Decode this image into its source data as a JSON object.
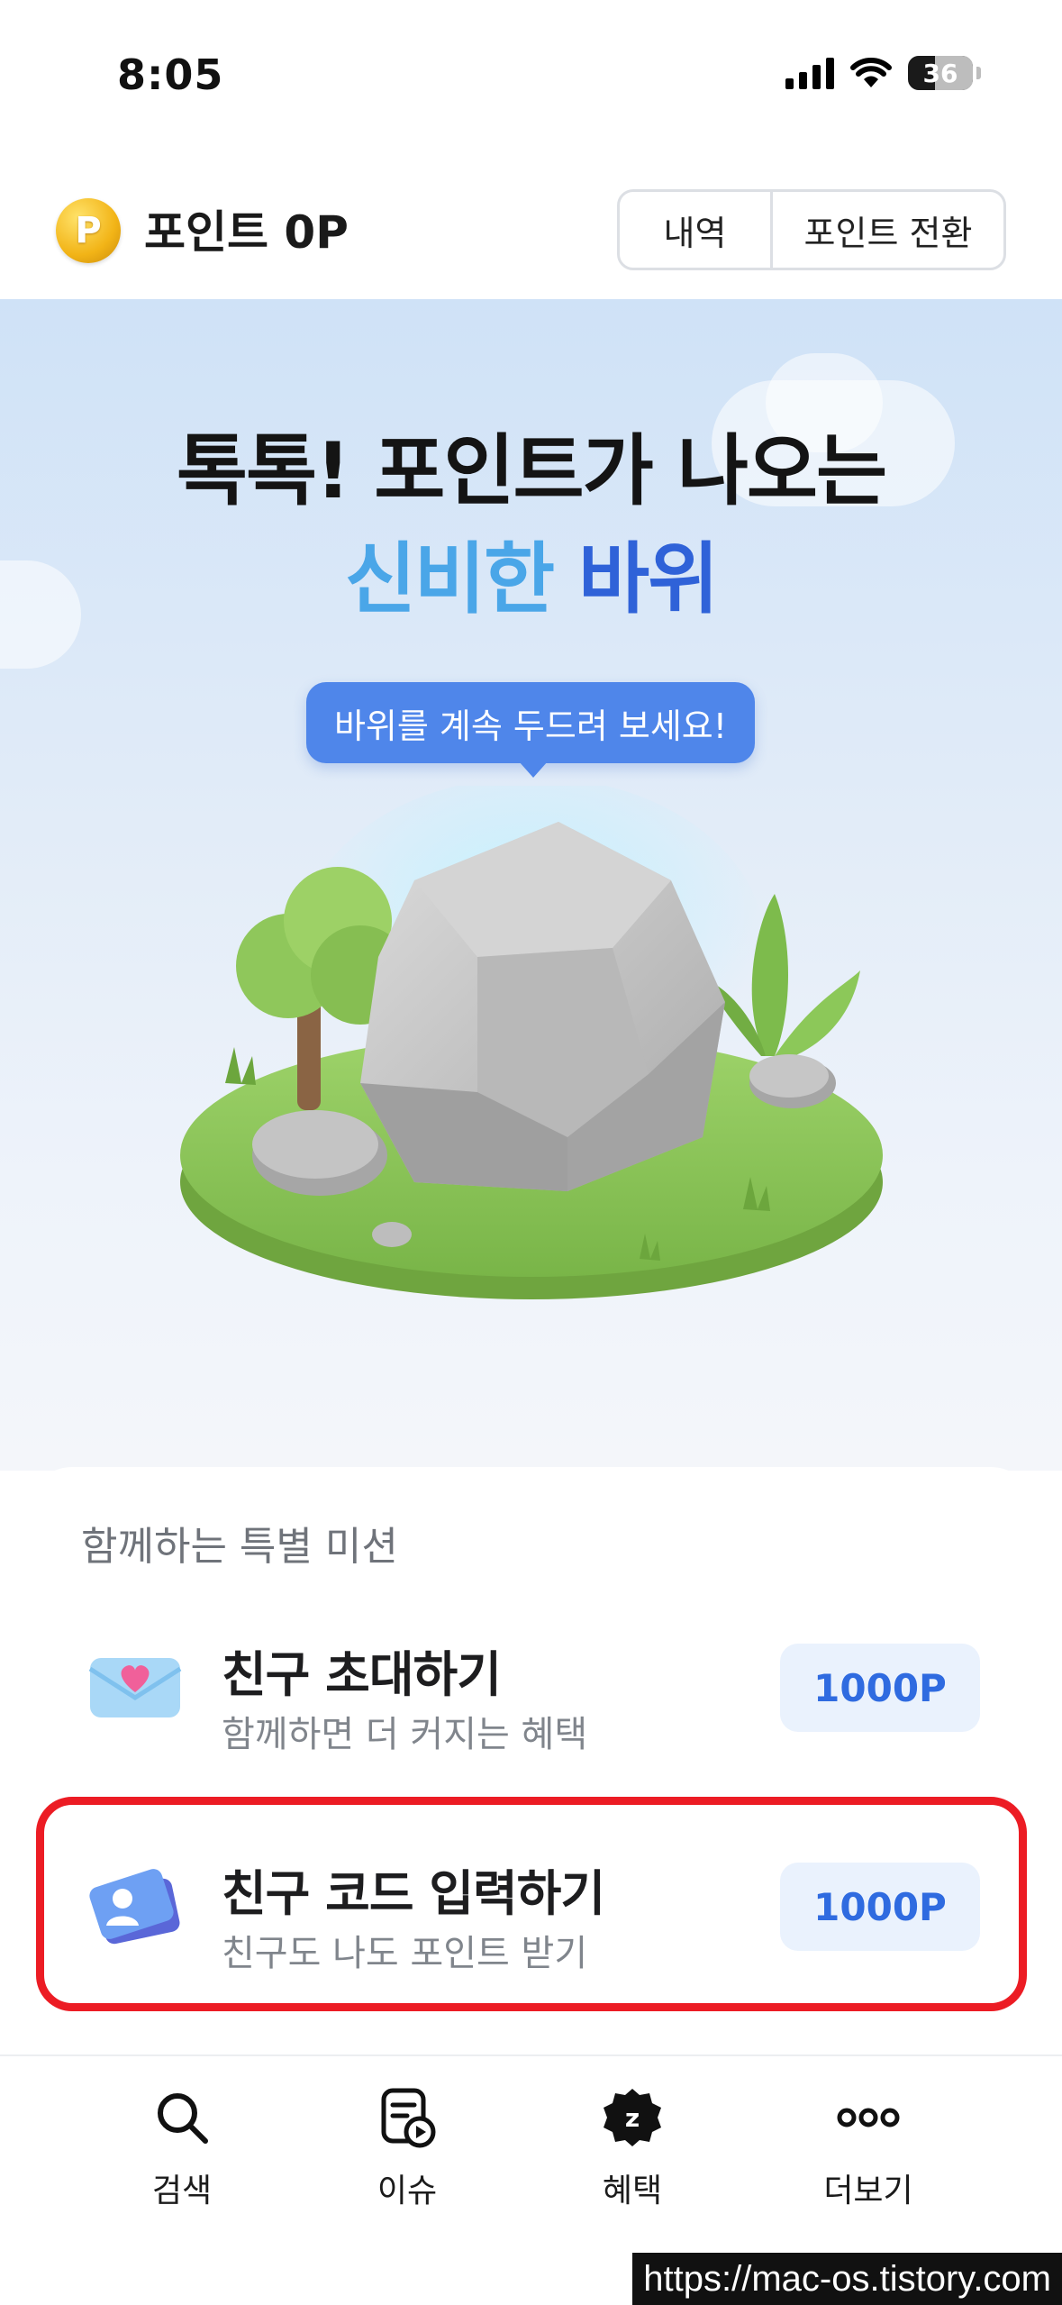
{
  "status_bar": {
    "time": "8:05",
    "battery": "36"
  },
  "header": {
    "coin_letter": "P",
    "point_label": "포인트 0P",
    "history_label": "내역",
    "convert_label": "포인트 전환"
  },
  "hero": {
    "title_line1": "톡톡! 포인트가 나오는",
    "title_line2_a": "신비한",
    "title_line2_b": "바위",
    "tooltip": "바위를 계속 두드려 보세요!"
  },
  "missions": {
    "title": "함께하는 특별 미션",
    "items": [
      {
        "name": "친구 초대하기",
        "desc": "함께하면 더 커지는 혜택",
        "reward": "1000P",
        "icon": "envelope-heart-icon"
      },
      {
        "name": "친구 코드 입력하기",
        "desc": "친구도 나도 포인트 받기",
        "reward": "1000P",
        "icon": "friend-card-icon"
      }
    ]
  },
  "bottom_nav": {
    "items": [
      {
        "label": "검색",
        "icon": "search-icon"
      },
      {
        "label": "이슈",
        "icon": "issue-doc-play-icon"
      },
      {
        "label": "혜택",
        "icon": "benefit-badge-icon"
      },
      {
        "label": "더보기",
        "icon": "more-dots-icon"
      }
    ]
  },
  "watermark": "https://mac-os.tistory.com",
  "colors": {
    "accent": "#2f6be0",
    "highlight": "#ec1c24",
    "tooltip": "#4f86ea"
  }
}
